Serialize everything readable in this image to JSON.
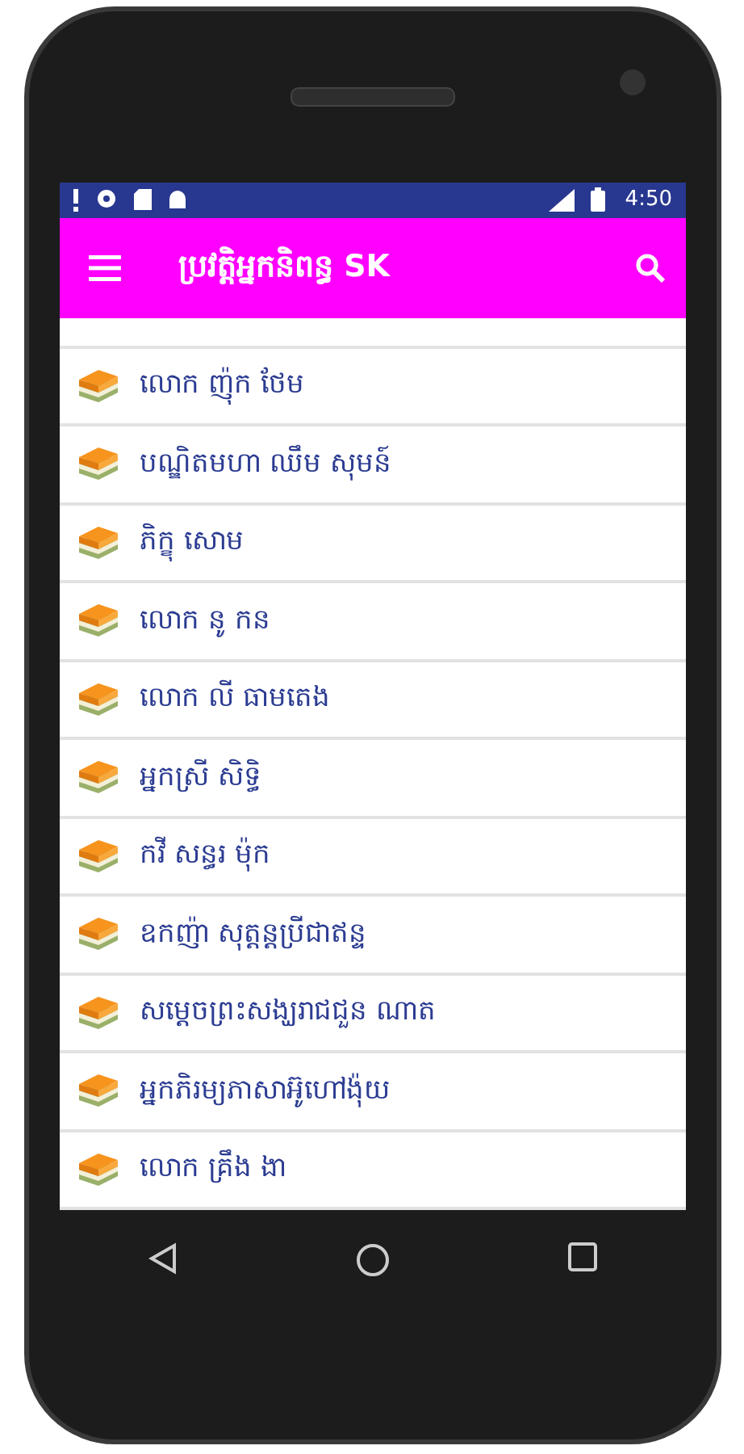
{
  "status_bar": {
    "time": "4:50"
  },
  "app_bar": {
    "title": "ប្រវត្តិអ្នកនិពន្ធ SK"
  },
  "items": [
    {
      "label": "លោក ញ៉ុក ថែម"
    },
    {
      "label": "បណ្ឌិតមហា ឈឹម សុមន៍"
    },
    {
      "label": "ភិក្ខុ សោម"
    },
    {
      "label": "លោក នូ កន"
    },
    {
      "label": "លោក លី ធាមតេង"
    },
    {
      "label": "អ្នកស្រី សិទ្ធិ"
    },
    {
      "label": "កវី សន្ធរ ម៉ុក"
    },
    {
      "label": "ឧកញ៉ា សុត្តន្តប្រីជាឥន្ទ"
    },
    {
      "label": "សម្តេចព្រះសង្ឃរាជជួន ណាត"
    },
    {
      "label": "អ្នកភិរម្យភាសាអ៊ូហៅង៉ុយ"
    },
    {
      "label": "លោក គ្រឹង ងា"
    }
  ]
}
